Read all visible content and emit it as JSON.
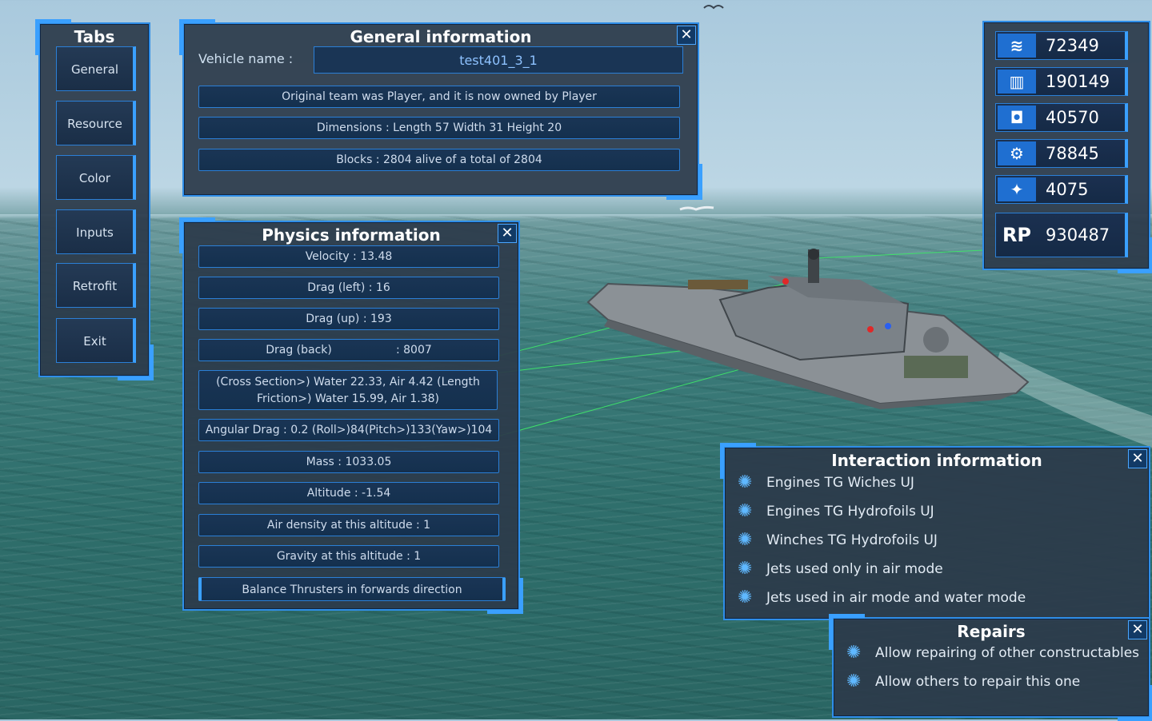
{
  "tabs": {
    "title": "Tabs",
    "items": [
      {
        "label": "General"
      },
      {
        "label": "Resource"
      },
      {
        "label": "Color"
      },
      {
        "label": "Inputs"
      },
      {
        "label": "Retrofit"
      },
      {
        "label": "Exit"
      }
    ]
  },
  "general": {
    "title": "General information",
    "close": "✕",
    "vehicle_name_label": "Vehicle name :",
    "vehicle_name_value": "test401_3_1",
    "rows": [
      "Original team was Player, and it is now owned by Player",
      "Dimensions : Length 57 Width 31 Height 20",
      "Blocks : 2804 alive of a total of 2804"
    ]
  },
  "physics": {
    "title": "Physics information",
    "close": "✕",
    "rows": [
      "Velocity : 13.48",
      "Drag (left) : 16",
      "Drag (up)  : 193",
      "Drag (back)                  : 8007",
      "(Cross Section>) Water 22.33, Air 4.42      (Length Friction>) Water 15.99, Air 1.38)",
      "Angular Drag : 0.2 (Roll>)84(Pitch>)133(Yaw>)104",
      "Mass : 1033.05",
      "Altitude : -1.54",
      "Air density at this altitude : 1",
      "Gravity at this altitude : 1"
    ],
    "balance": "Balance Thrusters in forwards direction"
  },
  "resources": {
    "items": [
      {
        "icon": "material-icon",
        "glyph": "≋",
        "value": "72349"
      },
      {
        "icon": "ammo-icon",
        "glyph": "▥",
        "value": "190149"
      },
      {
        "icon": "fuel-icon",
        "glyph": "◘",
        "value": "40570"
      },
      {
        "icon": "oil-icon",
        "glyph": "⚙",
        "value": "78845"
      },
      {
        "icon": "crystal-icon",
        "glyph": "✦",
        "value": "4075"
      },
      {
        "icon": "rp-icon",
        "glyph": "RP",
        "value": "930487"
      }
    ]
  },
  "interaction": {
    "title": "Interaction information",
    "close": "✕",
    "items": [
      "Engines TG Wiches UJ",
      "Engines TG Hydrofoils UJ",
      "Winches TG Hydrofoils UJ",
      "Jets used only in air mode",
      "Jets used in air mode and water mode"
    ]
  },
  "repairs": {
    "title": "Repairs",
    "close": "✕",
    "items": [
      "Allow repairing of other constructables",
      "Allow others to repair this one"
    ]
  },
  "colors": {
    "accent": "#3aa0ff",
    "panel": "#2c3a4a",
    "row": "#1a3555"
  }
}
